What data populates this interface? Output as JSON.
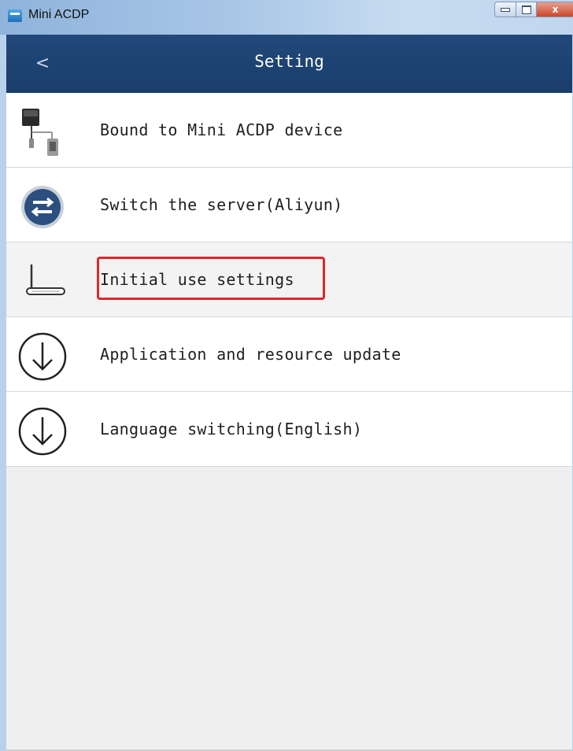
{
  "window": {
    "title": "Mini ACDP",
    "minimize_icon": "minimize-icon",
    "maximize_icon": "maximize-icon",
    "close_label": "x"
  },
  "header": {
    "back_label": "<",
    "title": "Setting"
  },
  "menu": [
    {
      "label": "Bound to Mini ACDP device",
      "icon": "device-binding-icon"
    },
    {
      "label": "Switch the server(Aliyun)",
      "icon": "switch-server-icon"
    },
    {
      "label": "Initial use settings",
      "icon": "router-icon",
      "highlighted": true
    },
    {
      "label": "Application and resource update",
      "icon": "download-arrow-icon"
    },
    {
      "label": "Language switching(English)",
      "icon": "download-arrow-icon"
    }
  ],
  "colors": {
    "header_bg": "#1f4574",
    "highlight_border": "#e0262b"
  }
}
